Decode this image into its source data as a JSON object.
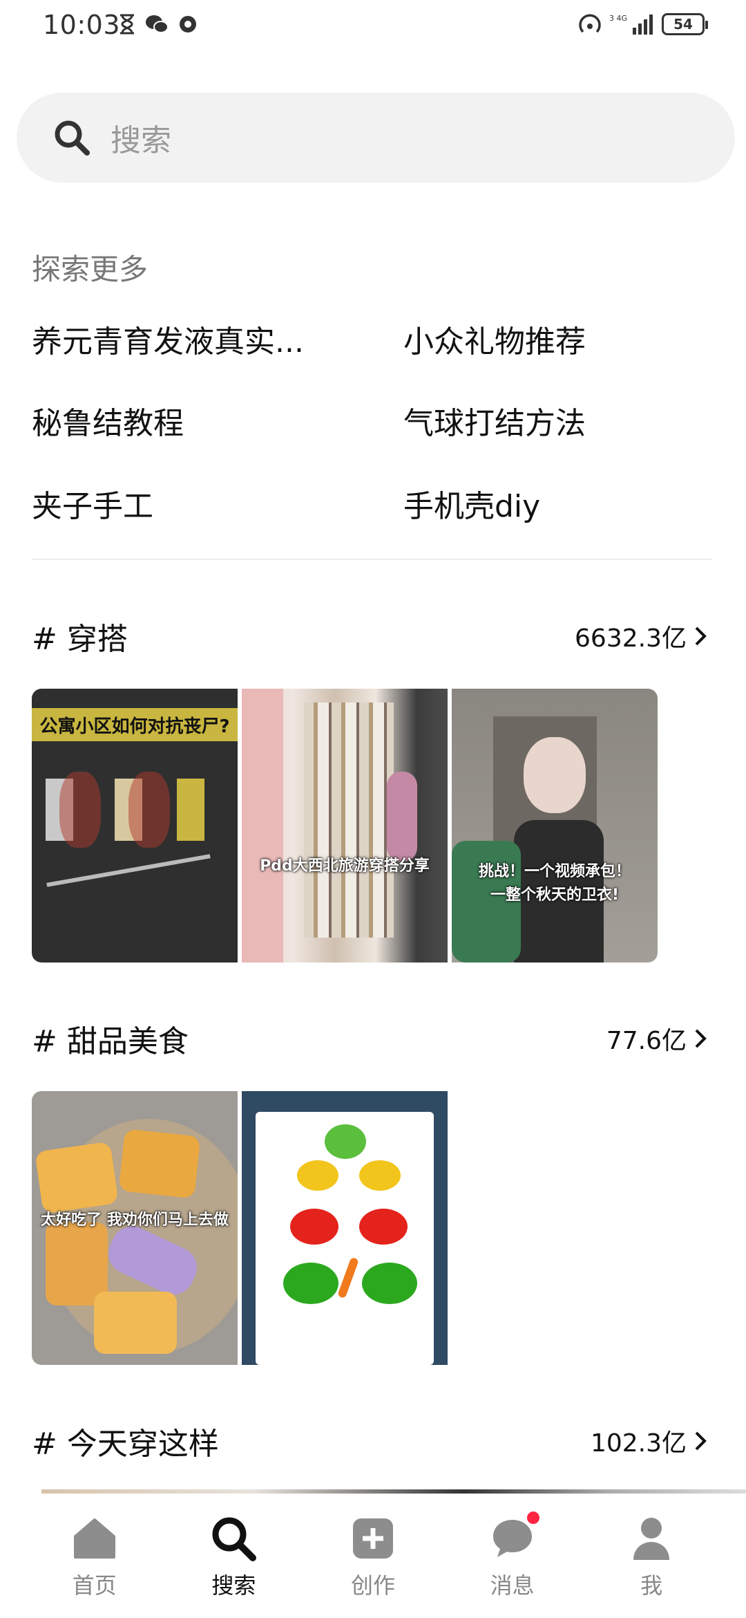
{
  "status_bar": {
    "time": "10:03",
    "battery": "54",
    "network": "4G"
  },
  "search": {
    "placeholder": "搜索"
  },
  "explore": {
    "title": "探索更多",
    "items": [
      "养元青育发液真实...",
      "小众礼物推荐",
      "秘鲁结教程",
      "气球打结方法",
      "夹子手工",
      "手机壳diy"
    ]
  },
  "sections": [
    {
      "title": "# 穿搭",
      "count": "6632.3亿",
      "thumbs": [
        {
          "caption_top": "公寓小区如何对抗丧尸?",
          "caption": ""
        },
        {
          "caption": "Pdd大西北旅游穿搭分享"
        },
        {
          "caption": "挑战！一个视频承包！",
          "caption2": "一整个秋天的卫衣!"
        }
      ]
    },
    {
      "title": "# 甜品美食",
      "count": "77.6亿",
      "thumbs": [
        {
          "caption": "太好吃了 我劝你们马上去做"
        },
        {
          "caption": ""
        }
      ]
    },
    {
      "title": "# 今天穿这样",
      "count": "102.3亿"
    }
  ],
  "nav": {
    "items": [
      {
        "label": "首页",
        "icon": "home-icon"
      },
      {
        "label": "搜索",
        "icon": "search-icon"
      },
      {
        "label": "创作",
        "icon": "create-icon"
      },
      {
        "label": "消息",
        "icon": "message-icon"
      },
      {
        "label": "我",
        "icon": "profile-icon"
      }
    ],
    "active_index": 1
  },
  "colors": {
    "accent": "#ff2442",
    "search_bg": "#f2f2f2",
    "muted_text": "#888888"
  }
}
